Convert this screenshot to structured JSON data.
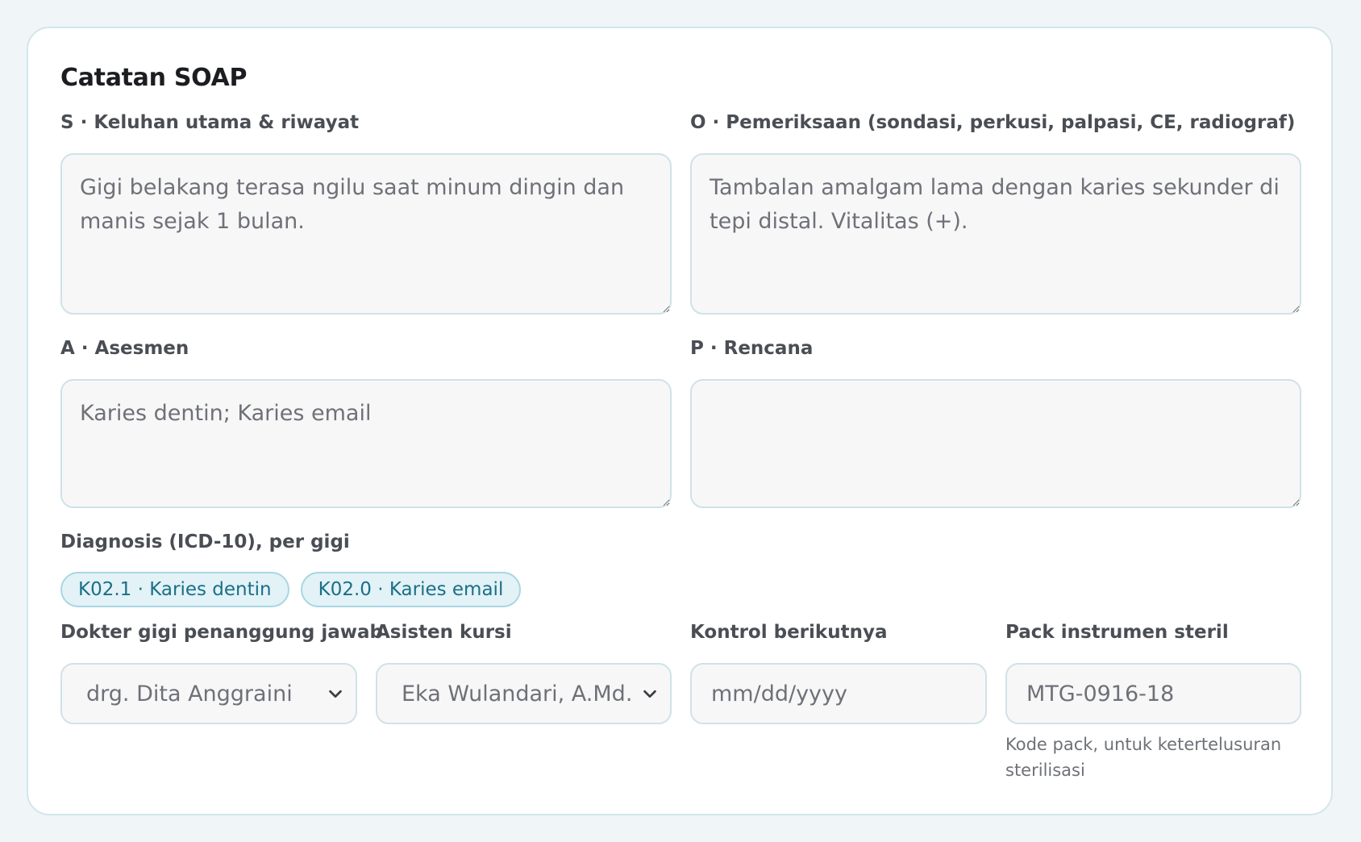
{
  "card": {
    "title": "Catatan SOAP"
  },
  "soap": {
    "s": {
      "label": "S · Keluhan utama & riwayat",
      "value": "Gigi belakang terasa ngilu saat minum dingin dan manis sejak 1 bulan."
    },
    "o": {
      "label": "O · Pemeriksaan (sondasi, perkusi, palpasi, CE, radiograf)",
      "value": "Tambalan amalgam lama dengan karies sekunder di tepi distal. Vitalitas (+)."
    },
    "a": {
      "label": "A · Asesmen",
      "value": "Karies dentin; Karies email"
    },
    "p": {
      "label": "P · Rencana",
      "value": ""
    }
  },
  "diagnosis": {
    "label": "Diagnosis (ICD-10), per gigi",
    "chips": [
      "K02.1 · Karies dentin",
      "K02.0 · Karies email"
    ]
  },
  "fields": {
    "dentist": {
      "label": "Dokter gigi penanggung jawab",
      "value": "drg. Dita Anggraini"
    },
    "assistant": {
      "label": "Asisten kursi",
      "value": "Eka Wulandari, A.Md.Kes"
    },
    "next_control": {
      "label": "Kontrol berikutnya",
      "placeholder": "mm/dd/yyyy"
    },
    "pack": {
      "label": "Pack instrumen steril",
      "value": "MTG-0916-18",
      "hint": "Kode pack, untuk ketertelusuran sterilisasi"
    }
  },
  "icons": {
    "select_arrow": "chevron-down-icon"
  },
  "colors": {
    "chip_bg": "#e2f2f7",
    "chip_text": "#1b6f86",
    "border": "#cfe2e9",
    "page_bg": "#f0f6f8"
  }
}
